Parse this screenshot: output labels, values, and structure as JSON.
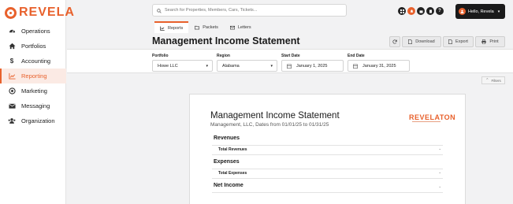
{
  "brand": {
    "name": "REVELA",
    "accent": "#e8612c"
  },
  "sidebar": {
    "items": [
      {
        "label": "Operations",
        "icon": "dashboard-gauge-icon"
      },
      {
        "label": "Portfolios",
        "icon": "home-icon"
      },
      {
        "label": "Accounting",
        "icon": "dollar-icon"
      },
      {
        "label": "Reporting",
        "icon": "chart-line-icon",
        "active": true
      },
      {
        "label": "Marketing",
        "icon": "target-icon"
      },
      {
        "label": "Messaging",
        "icon": "envelope-icon"
      },
      {
        "label": "Organization",
        "icon": "users-icon"
      }
    ]
  },
  "topbar": {
    "search_placeholder": "Search for Properties, Members, Cars, Tickets...",
    "user_label": "Hello, Revela"
  },
  "tabs": [
    {
      "label": "Reports",
      "active": true
    },
    {
      "label": "Packets"
    },
    {
      "label": "Letters"
    }
  ],
  "page": {
    "title": "Management Income Statement",
    "actions": {
      "download": "Download",
      "export": "Export",
      "print": "Print"
    }
  },
  "filters": {
    "portfolio": {
      "label": "Portfolio",
      "value": "Howe LLC"
    },
    "region": {
      "label": "Region",
      "value": "Alabama"
    },
    "start_date": {
      "label": "Start Date",
      "value": "January 1, 2025"
    },
    "end_date": {
      "label": "End Date",
      "value": "January 31, 2025"
    },
    "toggle_label": "Filters"
  },
  "report": {
    "title": "Management Income Statement",
    "subtitle": "Management, LLC, Dates from 01/01/25 to 01/31/25",
    "logo_text": "REVELATON",
    "sections": {
      "revenues": {
        "heading": "Revenues",
        "total_label": "Total Revenues",
        "total_value": "-"
      },
      "expenses": {
        "heading": "Expenses",
        "total_label": "Total Expenses",
        "total_value": "-"
      },
      "net_income": {
        "heading": "Net Income",
        "value": "-"
      }
    }
  }
}
